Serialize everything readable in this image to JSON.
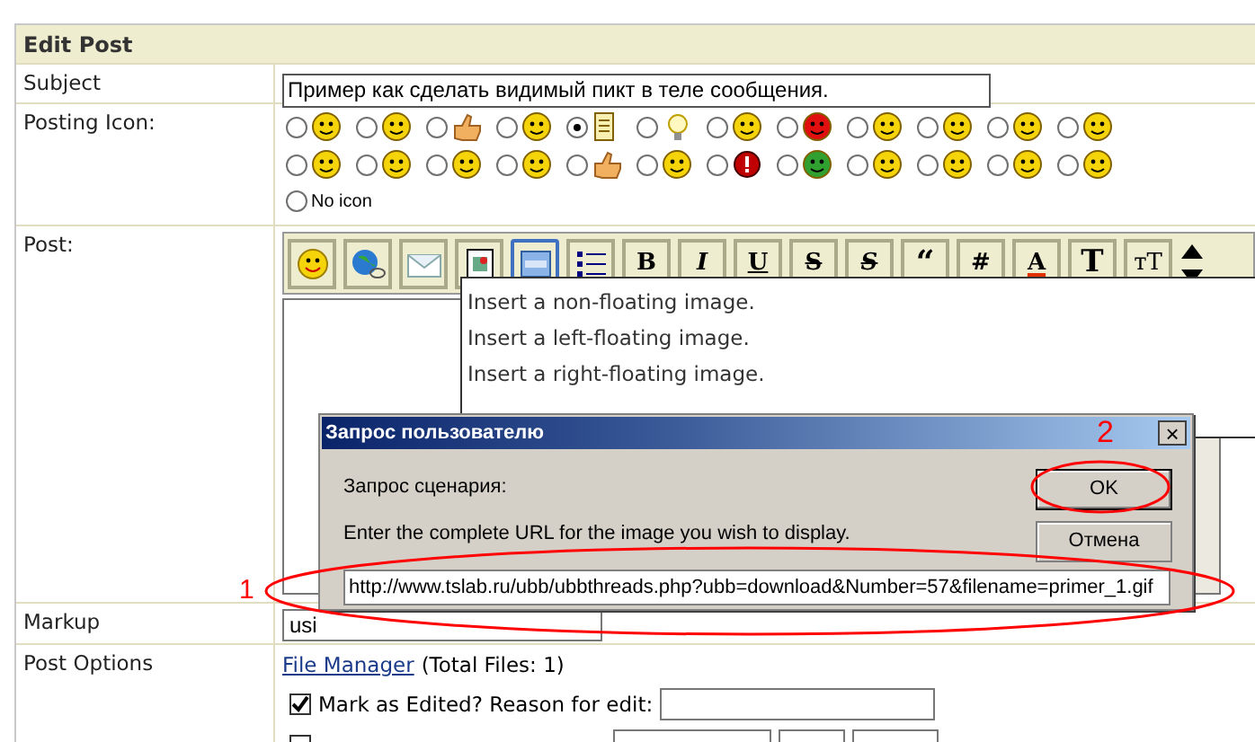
{
  "panel": {
    "title": "Edit Post"
  },
  "subject": {
    "label": "Subject",
    "value": "Пример как сделать видимый пикт в теле сообщения."
  },
  "posting_icon": {
    "label": "Posting Icon:",
    "icons": [
      {
        "selected": false
      },
      {
        "selected": false
      },
      {
        "selected": false
      },
      {
        "selected": false
      },
      {
        "selected": true
      },
      {
        "selected": false
      },
      {
        "selected": false
      },
      {
        "selected": false
      },
      {
        "selected": false
      },
      {
        "selected": false
      },
      {
        "selected": false
      },
      {
        "selected": false
      },
      {
        "selected": false
      },
      {
        "selected": false
      },
      {
        "selected": false
      },
      {
        "selected": false
      },
      {
        "selected": false
      },
      {
        "selected": false
      },
      {
        "selected": false
      },
      {
        "selected": false
      },
      {
        "selected": false
      },
      {
        "selected": false
      },
      {
        "selected": false
      },
      {
        "selected": false
      }
    ],
    "no_icon": {
      "label": "No icon",
      "selected": false
    }
  },
  "post": {
    "label": "Post:",
    "toolbar": [
      {
        "selected": false
      },
      {
        "selected": false
      },
      {
        "selected": false
      },
      {
        "selected": false
      },
      {
        "selected": true
      },
      {
        "selected": false
      },
      {
        "glyph": "B",
        "selected": false
      },
      {
        "glyph": "I",
        "selected": false
      },
      {
        "glyph": "U",
        "selected": false
      },
      {
        "glyph": "S",
        "selected": false
      },
      {
        "glyph": "S",
        "selected": false
      },
      {
        "glyph": "“",
        "selected": false
      },
      {
        "glyph": "#",
        "selected": false
      },
      {
        "glyph": "A",
        "selected": false
      },
      {
        "glyph": "T",
        "selected": false
      },
      {
        "glyph": "тT",
        "selected": false
      }
    ],
    "menu": [
      "Insert a non-floating image.",
      "Insert a left-floating image.",
      "Insert a right-floating image."
    ]
  },
  "markup": {
    "label": "Markup",
    "value": "usi"
  },
  "post_options": {
    "label": "Post Options",
    "file_manager": "File Manager",
    "total_files": "(Total Files: 1)",
    "mark_edited": {
      "label": "Mark as Edited? Reason for edit:",
      "checked": true
    },
    "second_option": {
      "checked": false
    }
  },
  "dialog": {
    "title": "Запрос пользователю",
    "close": "×",
    "prompt": "Запрос сценария:",
    "message": "Enter the complete URL for the image you wish to display.",
    "ok": "OK",
    "cancel": "Отмена",
    "value": "http://www.tslab.ru/ubb/ubbthreads.php?ubb=download&Number=57&filename=primer_1.gif"
  },
  "annotations": [
    "1",
    "2"
  ]
}
